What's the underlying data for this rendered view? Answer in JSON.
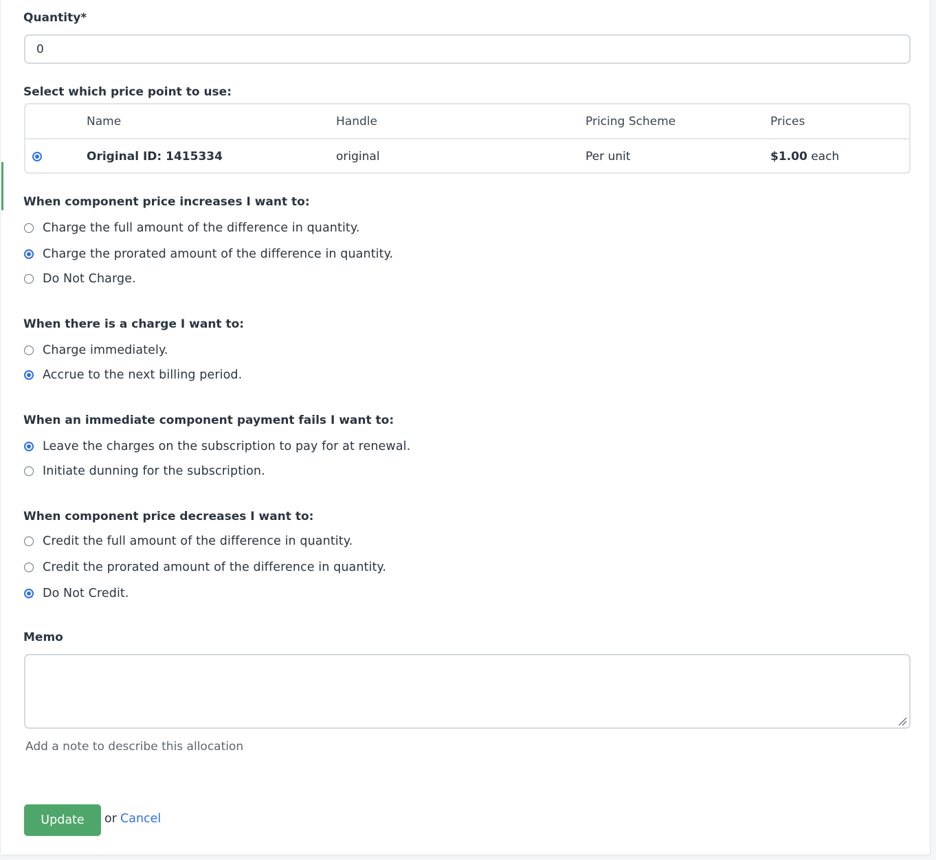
{
  "quantity": {
    "label": "Quantity*",
    "value": "0"
  },
  "price_point": {
    "label": "Select which price point to use:",
    "columns": [
      "Name",
      "Handle",
      "Pricing Scheme",
      "Prices"
    ],
    "rows": [
      {
        "selected": true,
        "name": "Original ID: 1415334",
        "handle": "original",
        "scheme": "Per unit",
        "price_amount": "$1.00",
        "price_suffix": "each"
      }
    ]
  },
  "increase": {
    "label": "When component price increases I want to:",
    "options": [
      {
        "text": "Charge the full amount of the difference in quantity.",
        "checked": false
      },
      {
        "text": "Charge the prorated amount of the difference in quantity.",
        "checked": true
      },
      {
        "text": "Do Not Charge.",
        "checked": false
      }
    ]
  },
  "charge_timing": {
    "label": "When there is a charge I want to:",
    "options": [
      {
        "text": "Charge immediately.",
        "checked": false
      },
      {
        "text": "Accrue to the next billing period.",
        "checked": true
      }
    ]
  },
  "payment_fail": {
    "label": "When an immediate component payment fails I want to:",
    "options": [
      {
        "text": "Leave the charges on the subscription to pay for at renewal.",
        "checked": true
      },
      {
        "text": "Initiate dunning for the subscription.",
        "checked": false
      }
    ]
  },
  "decrease": {
    "label": "When component price decreases I want to:",
    "options": [
      {
        "text": "Credit the full amount of the difference in quantity.",
        "checked": false
      },
      {
        "text": "Credit the prorated amount of the difference in quantity.",
        "checked": false
      },
      {
        "text": "Do Not Credit.",
        "checked": true
      }
    ]
  },
  "memo": {
    "label": "Memo",
    "value": "",
    "hint": "Add a note to describe this allocation"
  },
  "actions": {
    "update_label": "Update",
    "or_text": "or",
    "cancel_label": "Cancel"
  },
  "colors": {
    "accent_blue": "#2f6fea",
    "button_green": "#4fa66a",
    "text": "#2b3540",
    "border": "#d5d9de"
  }
}
